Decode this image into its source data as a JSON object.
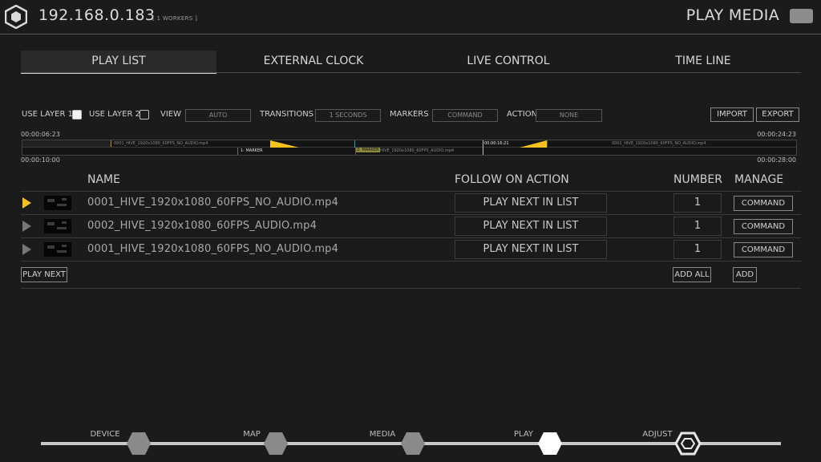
{
  "header": {
    "ip": "192.168.0.183",
    "workers": "[ 1 WORKERS ]",
    "page_title": "PLAY MEDIA"
  },
  "tabs": [
    {
      "label": "PLAY LIST",
      "active": true
    },
    {
      "label": "EXTERNAL CLOCK",
      "active": false
    },
    {
      "label": "LIVE CONTROL",
      "active": false
    },
    {
      "label": "TIME LINE",
      "active": false
    }
  ],
  "options": {
    "use_layer_1": "USE LAYER 1",
    "use_layer_2": "USE LAYER 2",
    "view_label": "VIEW",
    "view_value": "AUTO",
    "transitions_label": "TRANSITIONS",
    "transitions_value": "1 SECONDS",
    "markers_label": "MARKERS",
    "markers_value": "COMMAND",
    "action_label": "ACTION",
    "action_value": "NONE",
    "import": "IMPORT",
    "export": "EXPORT"
  },
  "timeline": {
    "top_left": "00:00:06:23",
    "top_right": "00:00:24:23",
    "bottom_left": "00:00:10:00",
    "bottom_right": "00:00:28:00",
    "clip1": "0001_HIVE_1920x1080_60FPS_NO_AUDIO.mp4",
    "marker1": "1: MARKER",
    "marker2": "2: MARKER",
    "clip2": "HIVE_1920x1080_60FPS_AUDIO.mp4",
    "playhead_time": "00:00:16:21",
    "clip3": "0001_HIVE_1920x1080_60FPS_NO_AUDIO.mp4"
  },
  "columns": {
    "name": "NAME",
    "follow": "FOLLOW ON ACTION",
    "number": "NUMBER",
    "manage": "MANAGE"
  },
  "rows": [
    {
      "name": "0001_HIVE_1920x1080_60FPS_NO_AUDIO.mp4",
      "action": "PLAY NEXT IN LIST",
      "number": "1",
      "manage": "COMMAND",
      "playing": true
    },
    {
      "name": "0002_HIVE_1920x1080_60FPS_AUDIO.mp4",
      "action": "PLAY NEXT IN LIST",
      "number": "1",
      "manage": "COMMAND",
      "playing": false
    },
    {
      "name": "0001_HIVE_1920x1080_60FPS_NO_AUDIO.mp4",
      "action": "PLAY NEXT IN LIST",
      "number": "1",
      "manage": "COMMAND",
      "playing": false
    }
  ],
  "actions": {
    "play_next": "PLAY NEXT",
    "add_all": "ADD ALL",
    "add": "ADD"
  },
  "steps": [
    {
      "label": "DEVICE"
    },
    {
      "label": "MAP"
    },
    {
      "label": "MEDIA"
    },
    {
      "label": "PLAY",
      "active": true
    },
    {
      "label": "ADJUST"
    }
  ],
  "colors": {
    "accent": "#f6c21b",
    "background": "#1b1b1b",
    "text": "#d2d2d2"
  }
}
